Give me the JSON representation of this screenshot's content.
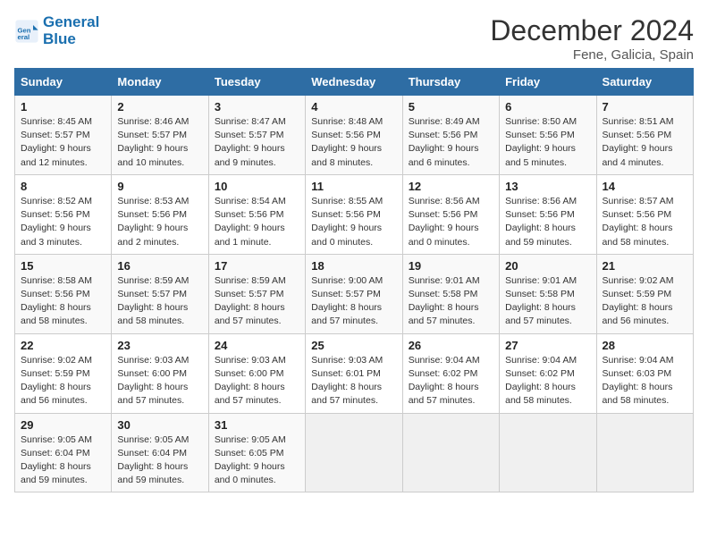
{
  "header": {
    "logo_line1": "General",
    "logo_line2": "Blue",
    "month": "December 2024",
    "location": "Fene, Galicia, Spain"
  },
  "weekdays": [
    "Sunday",
    "Monday",
    "Tuesday",
    "Wednesday",
    "Thursday",
    "Friday",
    "Saturday"
  ],
  "weeks": [
    [
      {
        "day": "1",
        "sunrise": "8:45 AM",
        "sunset": "5:57 PM",
        "daylight": "9 hours and 12 minutes."
      },
      {
        "day": "2",
        "sunrise": "8:46 AM",
        "sunset": "5:57 PM",
        "daylight": "9 hours and 10 minutes."
      },
      {
        "day": "3",
        "sunrise": "8:47 AM",
        "sunset": "5:57 PM",
        "daylight": "9 hours and 9 minutes."
      },
      {
        "day": "4",
        "sunrise": "8:48 AM",
        "sunset": "5:56 PM",
        "daylight": "9 hours and 8 minutes."
      },
      {
        "day": "5",
        "sunrise": "8:49 AM",
        "sunset": "5:56 PM",
        "daylight": "9 hours and 6 minutes."
      },
      {
        "day": "6",
        "sunrise": "8:50 AM",
        "sunset": "5:56 PM",
        "daylight": "9 hours and 5 minutes."
      },
      {
        "day": "7",
        "sunrise": "8:51 AM",
        "sunset": "5:56 PM",
        "daylight": "9 hours and 4 minutes."
      }
    ],
    [
      {
        "day": "8",
        "sunrise": "8:52 AM",
        "sunset": "5:56 PM",
        "daylight": "9 hours and 3 minutes."
      },
      {
        "day": "9",
        "sunrise": "8:53 AM",
        "sunset": "5:56 PM",
        "daylight": "9 hours and 2 minutes."
      },
      {
        "day": "10",
        "sunrise": "8:54 AM",
        "sunset": "5:56 PM",
        "daylight": "9 hours and 1 minute."
      },
      {
        "day": "11",
        "sunrise": "8:55 AM",
        "sunset": "5:56 PM",
        "daylight": "9 hours and 0 minutes."
      },
      {
        "day": "12",
        "sunrise": "8:56 AM",
        "sunset": "5:56 PM",
        "daylight": "9 hours and 0 minutes."
      },
      {
        "day": "13",
        "sunrise": "8:56 AM",
        "sunset": "5:56 PM",
        "daylight": "8 hours and 59 minutes."
      },
      {
        "day": "14",
        "sunrise": "8:57 AM",
        "sunset": "5:56 PM",
        "daylight": "8 hours and 58 minutes."
      }
    ],
    [
      {
        "day": "15",
        "sunrise": "8:58 AM",
        "sunset": "5:56 PM",
        "daylight": "8 hours and 58 minutes."
      },
      {
        "day": "16",
        "sunrise": "8:59 AM",
        "sunset": "5:57 PM",
        "daylight": "8 hours and 58 minutes."
      },
      {
        "day": "17",
        "sunrise": "8:59 AM",
        "sunset": "5:57 PM",
        "daylight": "8 hours and 57 minutes."
      },
      {
        "day": "18",
        "sunrise": "9:00 AM",
        "sunset": "5:57 PM",
        "daylight": "8 hours and 57 minutes."
      },
      {
        "day": "19",
        "sunrise": "9:01 AM",
        "sunset": "5:58 PM",
        "daylight": "8 hours and 57 minutes."
      },
      {
        "day": "20",
        "sunrise": "9:01 AM",
        "sunset": "5:58 PM",
        "daylight": "8 hours and 57 minutes."
      },
      {
        "day": "21",
        "sunrise": "9:02 AM",
        "sunset": "5:59 PM",
        "daylight": "8 hours and 56 minutes."
      }
    ],
    [
      {
        "day": "22",
        "sunrise": "9:02 AM",
        "sunset": "5:59 PM",
        "daylight": "8 hours and 56 minutes."
      },
      {
        "day": "23",
        "sunrise": "9:03 AM",
        "sunset": "6:00 PM",
        "daylight": "8 hours and 57 minutes."
      },
      {
        "day": "24",
        "sunrise": "9:03 AM",
        "sunset": "6:00 PM",
        "daylight": "8 hours and 57 minutes."
      },
      {
        "day": "25",
        "sunrise": "9:03 AM",
        "sunset": "6:01 PM",
        "daylight": "8 hours and 57 minutes."
      },
      {
        "day": "26",
        "sunrise": "9:04 AM",
        "sunset": "6:02 PM",
        "daylight": "8 hours and 57 minutes."
      },
      {
        "day": "27",
        "sunrise": "9:04 AM",
        "sunset": "6:02 PM",
        "daylight": "8 hours and 58 minutes."
      },
      {
        "day": "28",
        "sunrise": "9:04 AM",
        "sunset": "6:03 PM",
        "daylight": "8 hours and 58 minutes."
      }
    ],
    [
      {
        "day": "29",
        "sunrise": "9:05 AM",
        "sunset": "6:04 PM",
        "daylight": "8 hours and 59 minutes."
      },
      {
        "day": "30",
        "sunrise": "9:05 AM",
        "sunset": "6:04 PM",
        "daylight": "8 hours and 59 minutes."
      },
      {
        "day": "31",
        "sunrise": "9:05 AM",
        "sunset": "6:05 PM",
        "daylight": "9 hours and 0 minutes."
      },
      null,
      null,
      null,
      null
    ]
  ],
  "labels": {
    "sunrise": "Sunrise:",
    "sunset": "Sunset:",
    "daylight": "Daylight:"
  }
}
